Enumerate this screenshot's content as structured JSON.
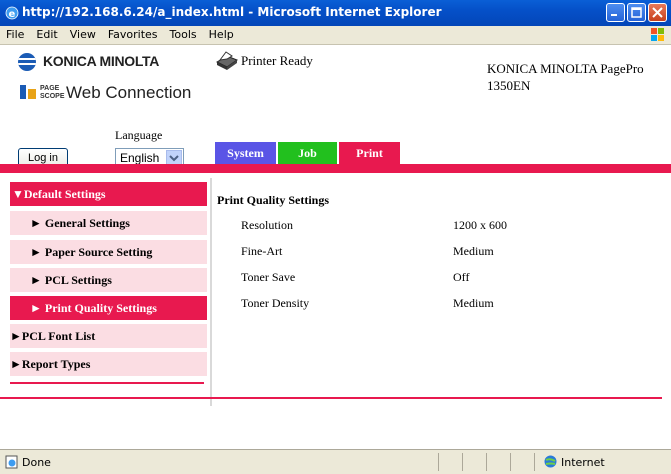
{
  "window": {
    "title": "http://192.168.6.24/a_index.html - Microsoft Internet Explorer"
  },
  "menu": [
    "File",
    "Edit",
    "View",
    "Favorites",
    "Tools",
    "Help"
  ],
  "header": {
    "brand": "KONICA MINOLTA",
    "pagescope_lines": [
      "PAGE",
      "SCOPE"
    ],
    "web_connection": "Web Connection",
    "printer_status": "Printer Ready",
    "model_line1": "KONICA MINOLTA PagePro",
    "model_line2": "1350EN",
    "language_label": "Language",
    "login_label": "Log in",
    "language_value": "English"
  },
  "tabs": [
    {
      "label": "System",
      "color": "#5a55e6"
    },
    {
      "label": "Job",
      "color": "#22c01e"
    },
    {
      "label": "Print",
      "color": "#e8194f"
    }
  ],
  "sidebar": {
    "items": [
      {
        "label": "▼Default Settings"
      },
      {
        "label": "► General Settings"
      },
      {
        "label": "► Paper Source Setting"
      },
      {
        "label": "► PCL Settings"
      },
      {
        "label": "► Print Quality Settings"
      },
      {
        "label": "►PCL Font List"
      },
      {
        "label": "►Report Types"
      }
    ]
  },
  "main": {
    "title": "Print Quality Settings",
    "rows": [
      {
        "label": "Resolution",
        "value": "1200 x 600"
      },
      {
        "label": "Fine-Art",
        "value": "Medium"
      },
      {
        "label": "Toner Save",
        "value": "Off"
      },
      {
        "label": "Toner Density",
        "value": "Medium"
      }
    ]
  },
  "statusbar": {
    "left": "Done",
    "zone": "Internet"
  },
  "colors": {
    "accent": "#e8194f",
    "light_pink": "#fbdde3",
    "titlebar": "#0a5fd6"
  }
}
